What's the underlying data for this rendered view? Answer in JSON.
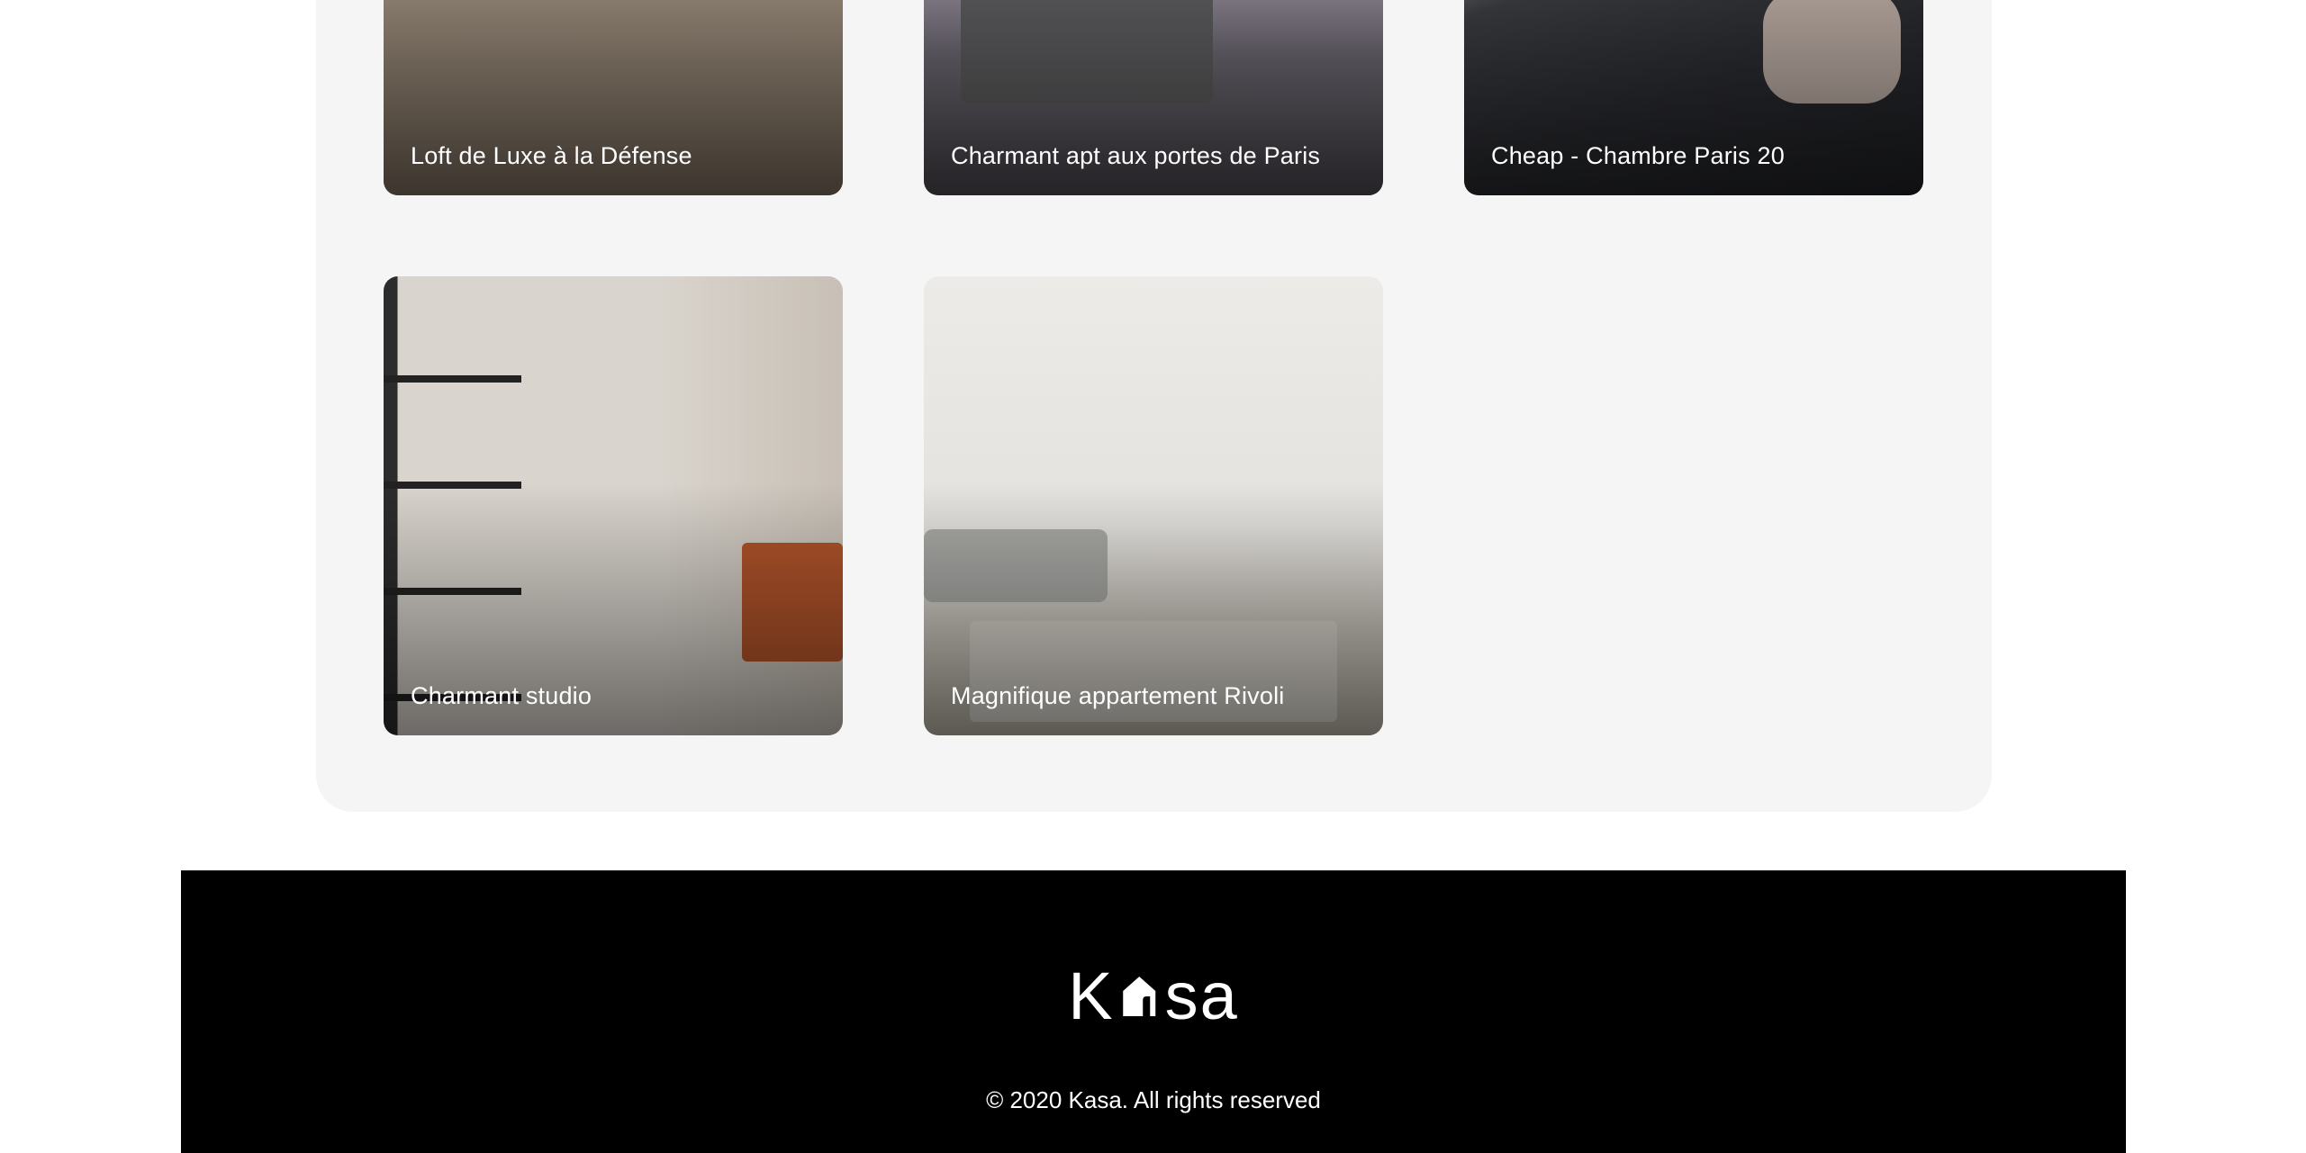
{
  "gallery": {
    "cards": [
      {
        "title": "Loft de Luxe à la Défense"
      },
      {
        "title": "Charmant apt aux portes de Paris"
      },
      {
        "title": "Cheap - Chambre Paris 20"
      },
      {
        "title": "Charmant studio"
      },
      {
        "title": "Magnifique appartement Rivoli"
      }
    ]
  },
  "footer": {
    "logo_left": "K",
    "logo_right": "sa",
    "copyright": "© 2020 Kasa. All rights reserved"
  },
  "colors": {
    "gallery_bg": "#f5f5f5",
    "footer_bg": "#000000",
    "text_on_dark": "#ffffff"
  }
}
